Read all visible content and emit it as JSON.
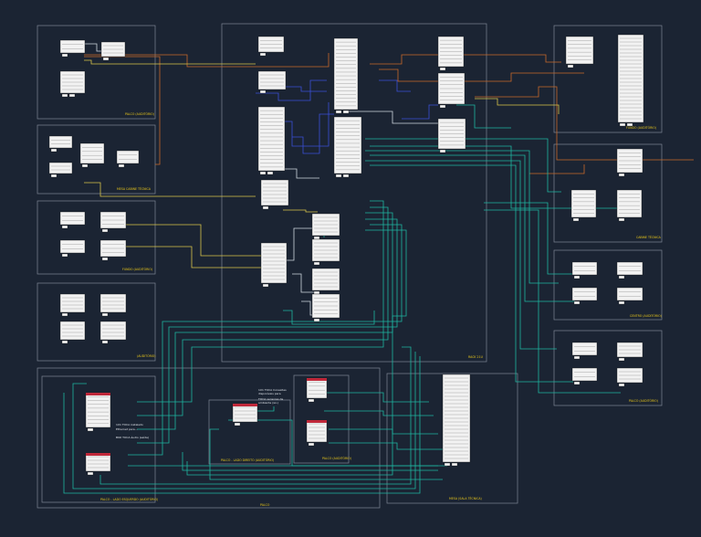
{
  "colors": {
    "background": "#1b2433",
    "frame": "#7d8794",
    "device_fill": "#f2f2f2",
    "device_stroke": "#1a1a1a",
    "label": "#e8c61a",
    "cable_teal": "#1fb5a0",
    "cable_blue": "#3a4fd6",
    "cable_orange": "#c9682a",
    "cable_yellow": "#d9c44a",
    "cable_white": "#cfd6de",
    "red_header": "#c0283a"
  },
  "areas": [
    {
      "id": "palco-audio-left",
      "label": "PALCO (AUDITÓRIO)"
    },
    {
      "id": "mesa-cabine",
      "label": "MESA CABINE TÉCNICA"
    },
    {
      "id": "fundo-audio",
      "label": "FUNDO (AUDITÓRIO)"
    },
    {
      "id": "auditorio",
      "label": "(AUDITÓRIO)"
    },
    {
      "id": "rack",
      "label": "RACK 21U"
    },
    {
      "id": "fundo-right",
      "label": "FUNDO (AUDITÓRIO)"
    },
    {
      "id": "cabine-tecnica",
      "label": "CABINE TÉCNICA"
    },
    {
      "id": "centro-audio",
      "label": "CENTRO (AUDITÓRIO)"
    },
    {
      "id": "palco-right",
      "label": "PALCO (AUDITÓRIO)"
    },
    {
      "id": "palco-bottom",
      "label": "PALCO"
    },
    {
      "id": "palco-lado-esq",
      "label": "PALCO - LADO ESQUERDO (AUDITÓRIO)"
    },
    {
      "id": "palco-lado-dir",
      "label": "PALCO - LADO DIREITO (AUDITÓRIO)"
    },
    {
      "id": "palco-audio-small",
      "label": "PALCO (AUDITÓRIO)"
    },
    {
      "id": "mesa-sala",
      "label": "MESA (SALA TÉCNICA)"
    }
  ],
  "notes": {
    "n1": [
      "1X1 TOCA instalado",
      "Ethernet para...",
      "BOX TOCA áudio (saída)"
    ],
    "n2": [
      "1X1 TOCA Conexões",
      "disponíveis para",
      "TOCA sensores de",
      "ambiente (wi-)"
    ],
    "n3": [
      "BOX TOCA áudio (saída)"
    ]
  }
}
